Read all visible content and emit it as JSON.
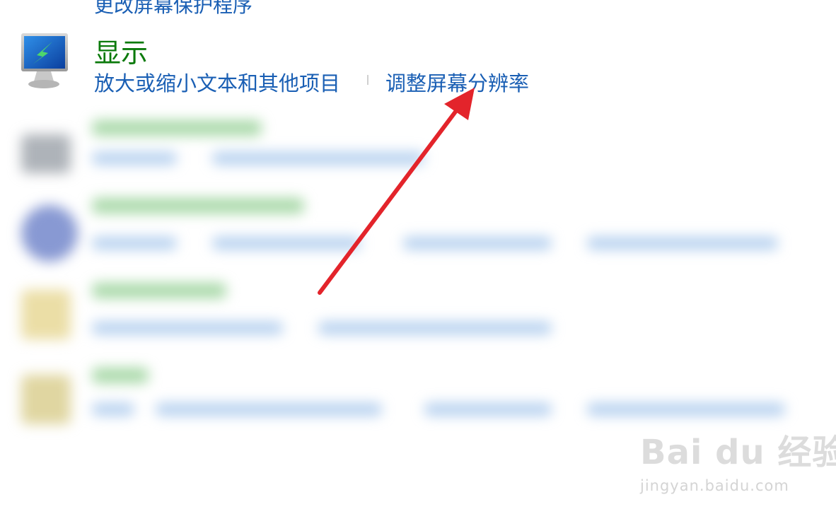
{
  "top_link": "更改屏幕保护程序",
  "category": {
    "title": "显示",
    "icon": "display-monitor-icon",
    "links": [
      "放大或缩小文本和其他项目",
      "调整屏幕分辨率"
    ]
  },
  "annotation": {
    "arrow_color": "#e3242b",
    "arrow_icon": "red-arrow-icon"
  },
  "watermark": {
    "logo_text": "Bai du 经验",
    "url": "jingyan.baidu.com"
  },
  "colors": {
    "title_green": "#0b7a0b",
    "link_blue": "#1a5fb4"
  }
}
